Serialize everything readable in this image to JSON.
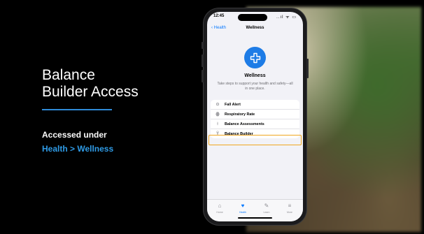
{
  "slide": {
    "title_line1": "Balance",
    "title_line2": "Builder Access",
    "subtitle_line1": "Accessed under",
    "subtitle_line2": "Health > Wellness",
    "accent_color": "#2f8ad8"
  },
  "phone": {
    "status_time": "12:45",
    "status_icons": "..ıl ᯤ ▭",
    "back_label": "‹ Health",
    "nav_title": "Wellness",
    "logo_icon": "plus-cross-icon",
    "heading": "Wellness",
    "description": "Take steps to support your health and safety—all in one place.",
    "items": [
      {
        "label": "Fall Alert",
        "icon": "fall-alert-icon",
        "glyph": "⊙"
      },
      {
        "label": "Respiratory Rate",
        "icon": "lungs-icon",
        "glyph": "ꙮ"
      },
      {
        "label": "Balance Assessments",
        "icon": "figure-icon",
        "glyph": "⍿"
      },
      {
        "label": "Balance Builder",
        "icon": "balance-icon",
        "glyph": "Ϋ"
      }
    ],
    "highlighted_item": "Balance Builder",
    "highlight_color": "#f0a61f",
    "tabs": [
      {
        "label": "Home",
        "icon": "house-icon",
        "glyph": "⌂",
        "active": false
      },
      {
        "label": "Health",
        "icon": "heart-icon",
        "glyph": "♥",
        "active": true
      },
      {
        "label": "Learn",
        "icon": "mortarboard-icon",
        "glyph": "✎",
        "active": false
      },
      {
        "label": "More",
        "icon": "menu-icon",
        "glyph": "≡",
        "active": false
      }
    ]
  }
}
